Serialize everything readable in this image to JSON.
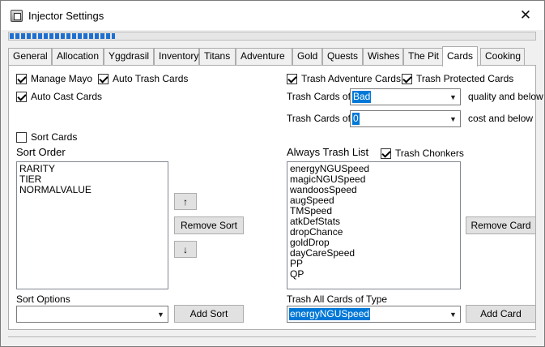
{
  "window": {
    "title": "Injector Settings",
    "progress_fraction": 0.2
  },
  "tabs": [
    {
      "label": "General"
    },
    {
      "label": "Allocation"
    },
    {
      "label": "Yggdrasil"
    },
    {
      "label": "Inventory"
    },
    {
      "label": "Titans"
    },
    {
      "label": "Adventure"
    },
    {
      "label": "Gold"
    },
    {
      "label": "Quests"
    },
    {
      "label": "Wishes"
    },
    {
      "label": "The Pit"
    },
    {
      "label": "Cards"
    },
    {
      "label": "Cooking"
    }
  ],
  "active_tab": "Cards",
  "left": {
    "manage_mayo": {
      "label": "Manage Mayo",
      "checked": true
    },
    "auto_trash_cards": {
      "label": "Auto Trash Cards",
      "checked": true
    },
    "auto_cast_cards": {
      "label": "Auto Cast Cards",
      "checked": true
    },
    "sort_cards": {
      "label": "Sort Cards",
      "checked": false
    },
    "sort_order_label": "Sort Order",
    "sort_order_items": [
      "RARITY",
      "TIER",
      "NORMALVALUE"
    ],
    "move_up_label": "↑",
    "remove_sort_label": "Remove Sort",
    "move_down_label": "↓",
    "sort_options_label": "Sort Options",
    "sort_options_value": "",
    "add_sort_label": "Add Sort"
  },
  "right": {
    "trash_adventure_cards": {
      "label": "Trash Adventure Cards",
      "checked": true
    },
    "trash_protected_cards": {
      "label": "Trash Protected Cards",
      "checked": true
    },
    "trash_quality_prefix": "Trash Cards of",
    "trash_quality_value": "Bad",
    "trash_quality_suffix": "quality and below",
    "trash_cost_prefix": "Trash Cards of",
    "trash_cost_value": "0",
    "trash_cost_suffix": "cost and below",
    "always_trash_label": "Always Trash List",
    "trash_chonkers": {
      "label": "Trash Chonkers",
      "checked": true
    },
    "always_trash_items": [
      "energyNGUSpeed",
      "magicNGUSpeed",
      "wandoosSpeed",
      "augSpeed",
      "TMSpeed",
      "atkDefStats",
      "dropChance",
      "goldDrop",
      "dayCareSpeed",
      "PP",
      "QP"
    ],
    "remove_card_label": "Remove Card",
    "trash_all_type_label": "Trash All Cards of Type",
    "trash_all_type_value": "energyNGUSpeed",
    "add_card_label": "Add Card"
  }
}
